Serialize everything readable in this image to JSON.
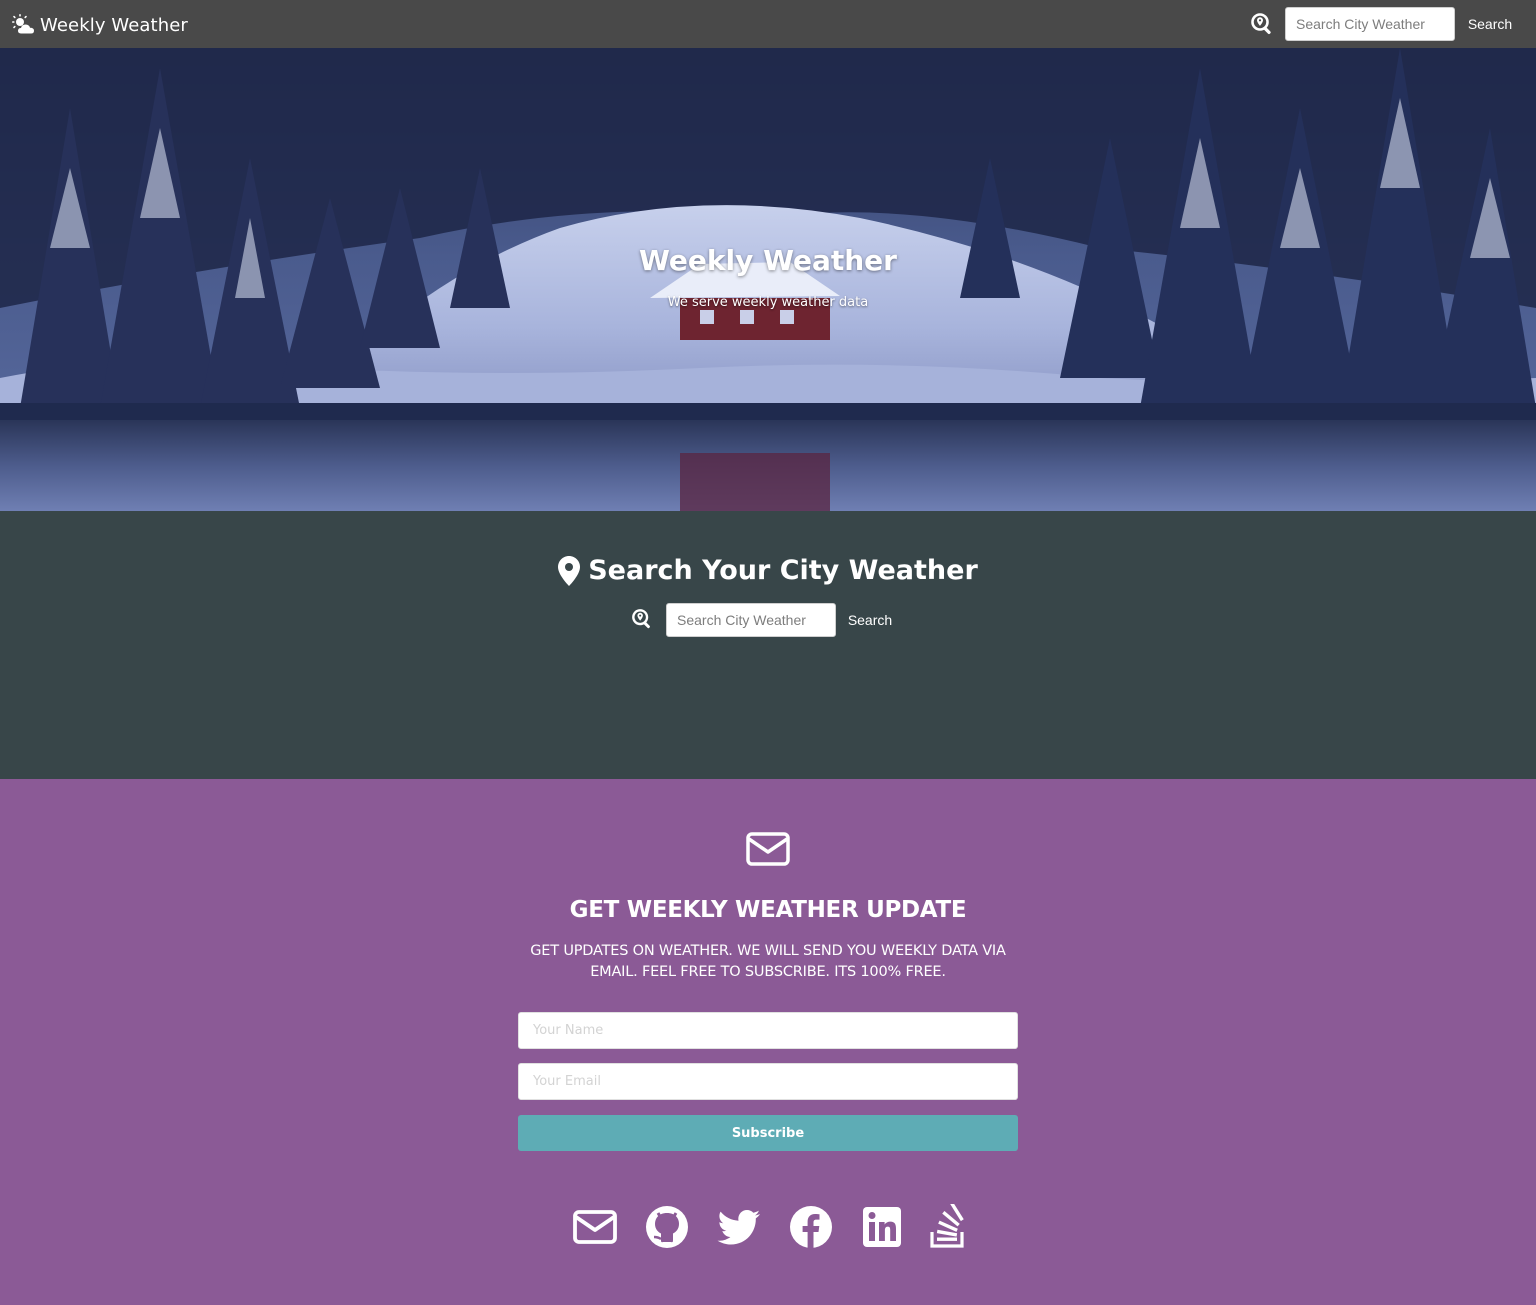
{
  "navbar": {
    "brand": "Weekly Weather",
    "brand_icon": "cloud-sun-icon",
    "search_icon": "search-location-icon",
    "search_placeholder": "Search City Weather",
    "search_button": "Search"
  },
  "hero": {
    "title": "Weekly Weather",
    "subtitle": "We serve weekly weather data",
    "background": "snowy-forest-cabin-lake-photo"
  },
  "city_search": {
    "heading": "Search Your City Weather",
    "heading_icon": "map-marker-icon",
    "search_icon": "search-location-icon",
    "search_placeholder": "Search City Weather",
    "search_button": "Search"
  },
  "subscribe": {
    "icon": "envelope-icon",
    "heading": "GET WEEKLY WEATHER UPDATE",
    "text": "GET UPDATES ON WEATHER. WE WILL SEND YOU WEEKLY DATA VIA EMAIL. FEEL FREE TO SUBSCRIBE. ITS 100% FREE.",
    "name_placeholder": "Your Name",
    "email_placeholder": "Your Email",
    "button": "Subscribe"
  },
  "social_links": [
    {
      "name": "email",
      "icon": "envelope-icon"
    },
    {
      "name": "github",
      "icon": "github-icon"
    },
    {
      "name": "twitter",
      "icon": "twitter-icon"
    },
    {
      "name": "facebook",
      "icon": "facebook-icon"
    },
    {
      "name": "linkedin",
      "icon": "linkedin-icon"
    },
    {
      "name": "stack-overflow",
      "icon": "stack-overflow-icon"
    }
  ],
  "colors": {
    "navbar_bg": "#494949",
    "city_section_bg": "#384649",
    "subscribe_section_bg": "#8b5a96",
    "subscribe_button_bg": "#5eacb5",
    "text_light": "#ffffff"
  }
}
